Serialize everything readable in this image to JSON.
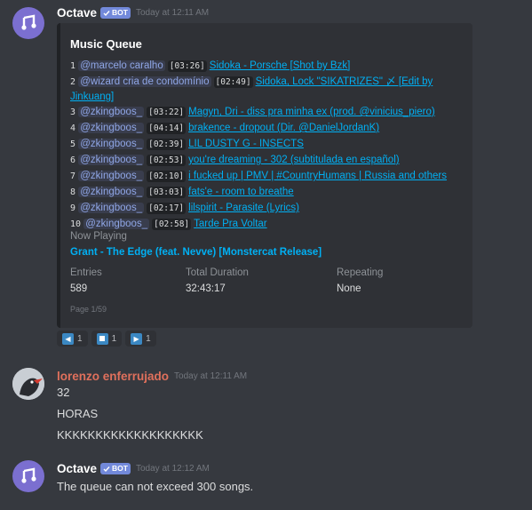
{
  "messages": [
    {
      "author": "Octave",
      "bot_badge": "BOT",
      "timestamp": "Today at 12:11 AM",
      "embed": {
        "title": "Music Queue",
        "queue": [
          {
            "n": "1",
            "user": "@marcelo caralho",
            "dur": "[03:26]",
            "title": "Sidoka - Porsche [Shot by Bzk]"
          },
          {
            "n": "2",
            "user": "@wizard cria de condomínio",
            "dur": "[02:49]",
            "title": "Sidoka, Lock \"SIKATRIZES\" 〆 [Edit by Jinkuang]"
          },
          {
            "n": "3",
            "user": "@zkingboos_",
            "dur": "[03:22]",
            "title": "Magyn, Dri - diss pra minha ex (prod. @vinicius_piero)"
          },
          {
            "n": "4",
            "user": "@zkingboos_",
            "dur": "[04:14]",
            "title": "brakence - dropout (Dir. @DanielJordanK)"
          },
          {
            "n": "5",
            "user": "@zkingboos_",
            "dur": "[02:39]",
            "title": "LIL DUSTY G - INSECTS"
          },
          {
            "n": "6",
            "user": "@zkingboos_",
            "dur": "[02:53]",
            "title": "you're dreaming - 302 (subtitulada en español)"
          },
          {
            "n": "7",
            "user": "@zkingboos_",
            "dur": "[02:10]",
            "title": "i fucked up | PMV | #CountryHumans | Russia and others"
          },
          {
            "n": "8",
            "user": "@zkingboos_",
            "dur": "[03:03]",
            "title": "fats'e - room to breathe"
          },
          {
            "n": "9",
            "user": "@zkingboos_",
            "dur": "[02:17]",
            "title": "lilspirit - Parasite (Lyrics)"
          },
          {
            "n": "10",
            "user": "@zkingboos_",
            "dur": "[02:58]",
            "title": "Tarde Pra Voltar"
          }
        ],
        "now_playing_label": "Now Playing",
        "now_playing": "Grant - The Edge (feat. Nevve) [Monstercat Release]",
        "fields": [
          {
            "label": "Entries",
            "value": "589"
          },
          {
            "label": "Total Duration",
            "value": "32:43:17"
          },
          {
            "label": "Repeating",
            "value": "None"
          }
        ],
        "footer": "Page 1/59"
      },
      "reactions": [
        {
          "icon": "previous-arrow-icon",
          "count": "1"
        },
        {
          "icon": "stop-square-icon",
          "count": "1"
        },
        {
          "icon": "next-arrow-icon",
          "count": "1"
        }
      ]
    },
    {
      "author": "lorenzo enferrujado",
      "timestamp": "Today at 12:11 AM",
      "lines": [
        "32",
        "HORAS",
        "KKKKKKKKKKKKKKKKKKK"
      ]
    },
    {
      "author": "Octave",
      "bot_badge": "BOT",
      "timestamp": "Today at 12:12 AM",
      "text": "The queue can not exceed 300 songs."
    }
  ]
}
